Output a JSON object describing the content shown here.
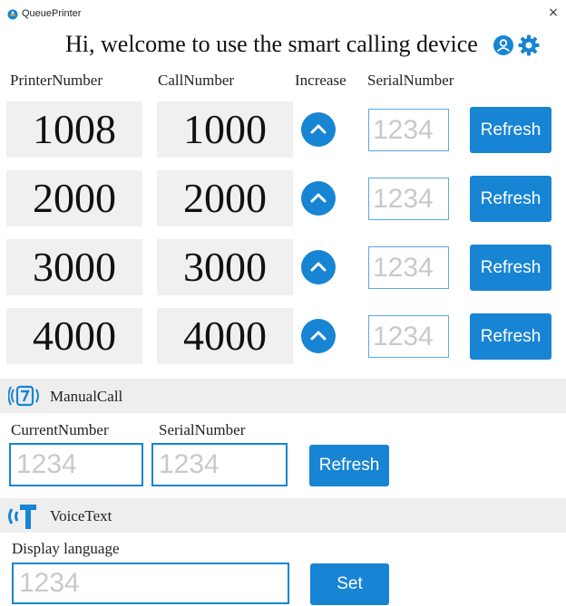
{
  "window": {
    "title": "QueuePrinter",
    "close_glyph": "×"
  },
  "header": {
    "welcome": "Hi, welcome to use the smart calling device",
    "icons": [
      "user-icon",
      "gear-icon"
    ]
  },
  "columns": {
    "printer": "PrinterNumber",
    "call": "CallNumber",
    "increase": "Increase",
    "serial": "SerialNumber"
  },
  "rows": [
    {
      "printer": "1008",
      "call": "1000",
      "serial_placeholder": "1234",
      "refresh_label": "Refresh"
    },
    {
      "printer": "2000",
      "call": "2000",
      "serial_placeholder": "1234",
      "refresh_label": "Refresh"
    },
    {
      "printer": "3000",
      "call": "3000",
      "serial_placeholder": "1234",
      "refresh_label": "Refresh"
    },
    {
      "printer": "4000",
      "call": "4000",
      "serial_placeholder": "1234",
      "refresh_label": "Refresh"
    }
  ],
  "manual_call": {
    "section_label": "ManualCall",
    "current_label": "CurrentNumber",
    "serial_label": "SerialNumber",
    "current_placeholder": "1234",
    "serial_placeholder": "1234",
    "refresh_label": "Refresh"
  },
  "voice_text": {
    "section_label": "VoiceText",
    "language_label": "Display language",
    "language_placeholder": "1234",
    "set_label": "Set"
  },
  "colors": {
    "accent": "#1784d4",
    "section_bg": "#eeeeee",
    "number_bg": "#f0f0f0",
    "placeholder": "#c9c9c9"
  }
}
